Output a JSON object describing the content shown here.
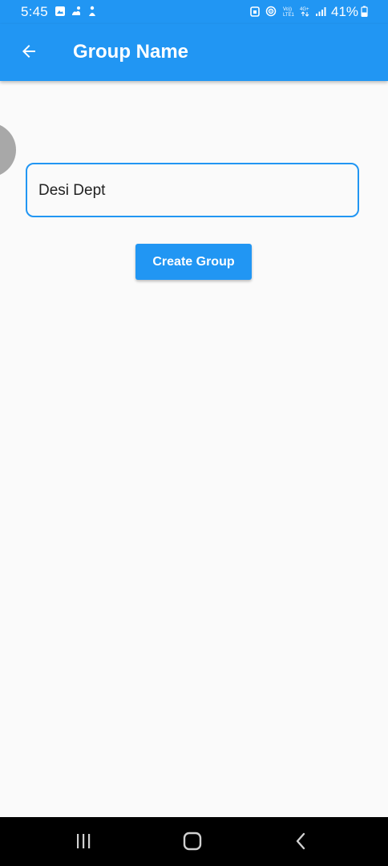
{
  "status_bar": {
    "time": "5:45",
    "battery": "41%",
    "icons": [
      "gallery-icon",
      "hands-icon",
      "person-icon",
      "alarm-icon",
      "hotspot-icon",
      "volte-icon",
      "4g-icon",
      "signal-icon",
      "battery-icon"
    ]
  },
  "app_bar": {
    "title": "Group Name",
    "back_icon": "arrow-left-icon"
  },
  "form": {
    "group_name_value": "Desi Dept",
    "create_label": "Create Group"
  },
  "nav_bar": {
    "icons": [
      "recent-apps-icon",
      "home-icon",
      "back-icon"
    ]
  },
  "colors": {
    "accent": "#2196f3",
    "background": "#fafafa",
    "avatar": "#a8a8a8"
  }
}
